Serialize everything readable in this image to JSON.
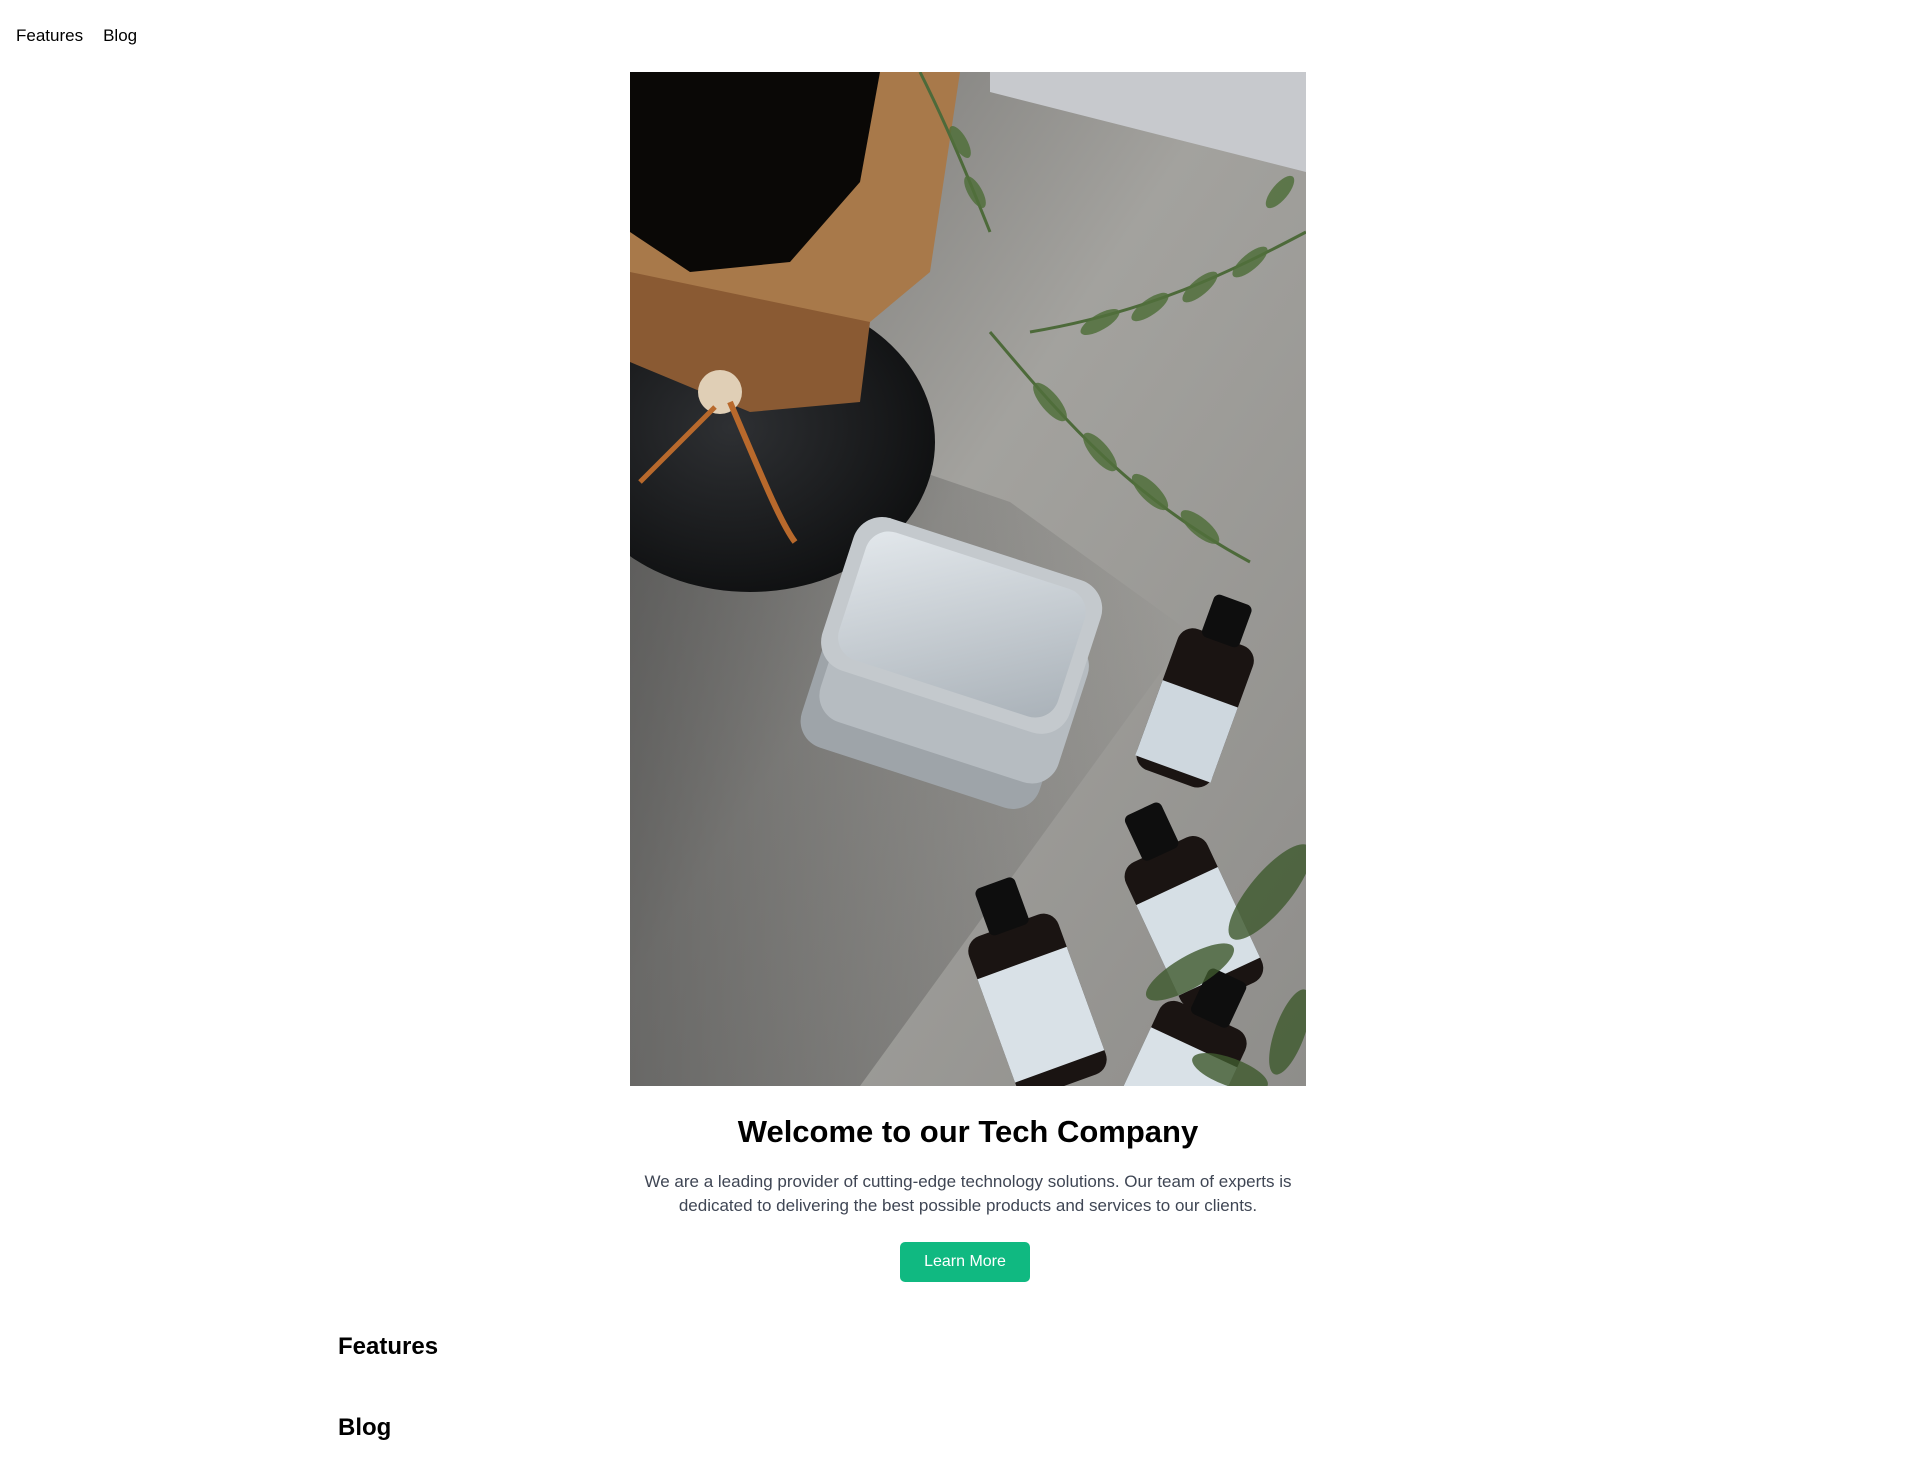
{
  "nav": {
    "items": [
      {
        "label": "Features"
      },
      {
        "label": "Blog"
      }
    ]
  },
  "hero": {
    "image_icon": "photo-image",
    "title": "Welcome to our Tech Company",
    "text": "We are a leading provider of cutting-edge technology solutions. Our team of experts is dedicated to delivering the best possible products and services to our clients.",
    "button_label": "Learn More"
  },
  "sections": {
    "features_heading": "Features",
    "blog_heading": "Blog"
  },
  "colors": {
    "accent": "#10b981",
    "body_text": "#3f4654",
    "heading": "#000000"
  }
}
